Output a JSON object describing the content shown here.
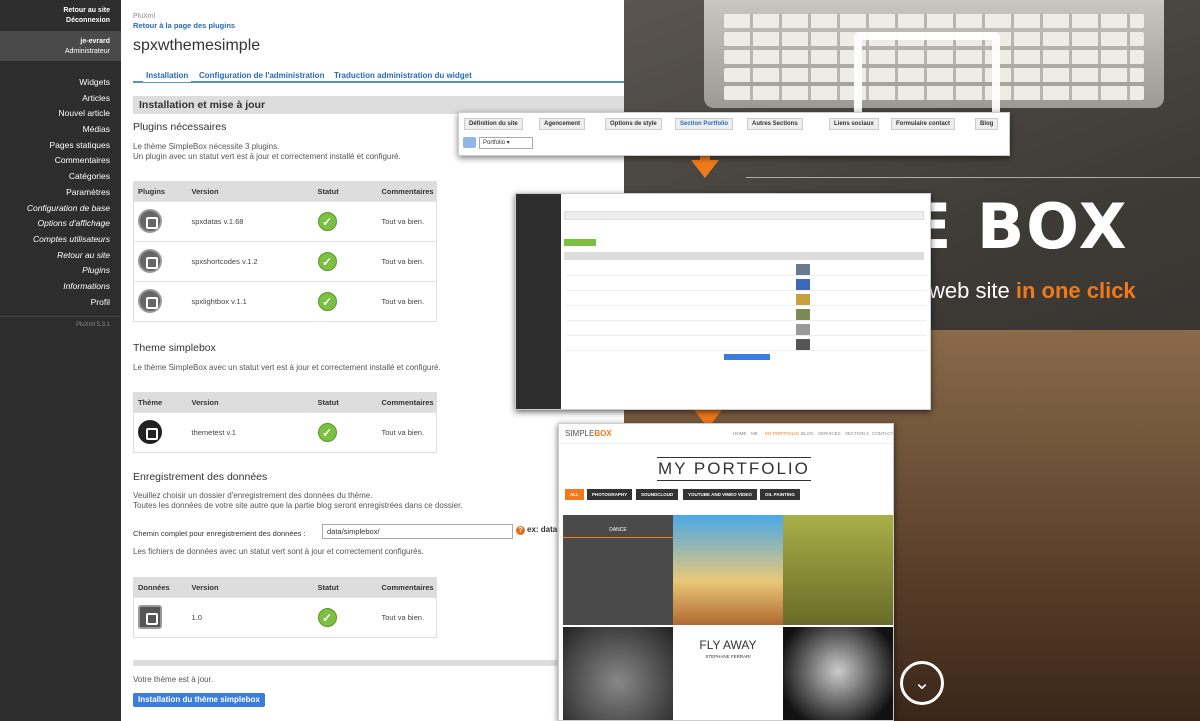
{
  "sidebar": {
    "back_to_site": "Retour au site",
    "logout": "Déconnexion",
    "username": "je-evrard",
    "role": "Administrateur",
    "items": [
      {
        "label": "Widgets",
        "italic": false
      },
      {
        "label": "Articles",
        "italic": false
      },
      {
        "label": "Nouvel article",
        "italic": false
      },
      {
        "label": "Médias",
        "italic": false
      },
      {
        "label": "Pages statiques",
        "italic": false
      },
      {
        "label": "Commentaires",
        "italic": false
      },
      {
        "label": "Catégories",
        "italic": false
      },
      {
        "label": "Paramètres",
        "italic": false
      },
      {
        "label": "Configuration de base",
        "italic": true
      },
      {
        "label": "Options d'affichage",
        "italic": true
      },
      {
        "label": "Comptes utilisateurs",
        "italic": true
      },
      {
        "label": "Retour au site",
        "italic": true
      },
      {
        "label": "Plugins",
        "italic": true
      },
      {
        "label": "Informations",
        "italic": true
      },
      {
        "label": "Profil",
        "italic": false
      }
    ],
    "version": "PluXml 5.3.1"
  },
  "admin": {
    "crumb": "PluXml",
    "back_link": "Retour à la page des plugins",
    "title": "spxwthemesimple",
    "tabs": [
      "Installation",
      "Configuration de l'administration",
      "Traduction administration du widget"
    ],
    "section_title": "Installation et mise à jour",
    "plugins": {
      "heading": "Plugins nécessaires",
      "line1": "Le thème SimpleBox nécessite 3 plugins.",
      "line2": "Un plugin avec un statut vert est à jour et correctement installé et configuré.",
      "columns": [
        "Plugins",
        "Version",
        "Statut",
        "Commentaires"
      ],
      "rows": [
        {
          "version": "spxdatas v.1.68",
          "comment": "Tout va bien."
        },
        {
          "version": "spxshortcodes v.1.2",
          "comment": "Tout va bien."
        },
        {
          "version": "spxlightbox v.1.1",
          "comment": "Tout va bien."
        }
      ]
    },
    "theme": {
      "heading": "Theme simplebox",
      "line1": "Le thème SimpleBox avec un statut vert est à jour et correctement installé et configuré.",
      "columns": [
        "Thème",
        "Version",
        "Statut",
        "Commentaires"
      ],
      "row": {
        "version": "themetest v.1",
        "comment": "Tout va bien."
      }
    },
    "data": {
      "heading": "Enregistrement des données",
      "line1": "Veuillez choisir un dossier d'enregistrement des données du thème.",
      "line2": "Toutes les données de votre site autre que la partie blog seront enregistrées dans ce dossier.",
      "field_label": "Chemin complet pour enregistrement des données :",
      "field_value": "data/simplebox/",
      "help": "ex: data",
      "line3": "Les fichiers de données avec un statut vert sont à jour et correctement configurés.",
      "columns": [
        "Données",
        "Version",
        "Statut",
        "Commentaires"
      ],
      "row": {
        "version": "1.0",
        "comment": "Tout va bien."
      }
    },
    "footer_text": "Votre thème est à jour.",
    "install_button": "Installation du thème simplebox"
  },
  "promo": {
    "big_title": "E BOX",
    "tag_prefix": "web site",
    "tag_highlight": "in one click",
    "tabs": [
      "Définition du site",
      "Agencement",
      "Options de style",
      "Section Portfolio",
      "Autres Sections",
      "Liens sociaux",
      "Formulaire contact",
      "Blog"
    ],
    "active_tab": "Section Portfolio",
    "select_value": "Portfolio",
    "site_brand_plain": "SIMPLE",
    "site_brand_bold": "BOX",
    "site_nav": [
      "HOME",
      "ME",
      "MY PORTFOLIO",
      "BLOG",
      "SERVICES",
      "SECTION 4",
      "CONTACT"
    ],
    "site_title": "MY PORTFOLIO",
    "filters": [
      "ALL",
      "PHOTOGRAPHY",
      "SOUNDCLOUD",
      "YOUTUBE AND VIMEO VIDEO",
      "OIL PAINTING"
    ],
    "tile_dance": "DANCE",
    "tile_fly": "FLY AWAY",
    "tile_fly_sub": "STEPHANE FERRARI"
  },
  "colors": {
    "accent": "#f07a1a",
    "link": "#2a6ab8",
    "status_ok": "#7bc043",
    "sidebar": "#2d2d2d"
  }
}
